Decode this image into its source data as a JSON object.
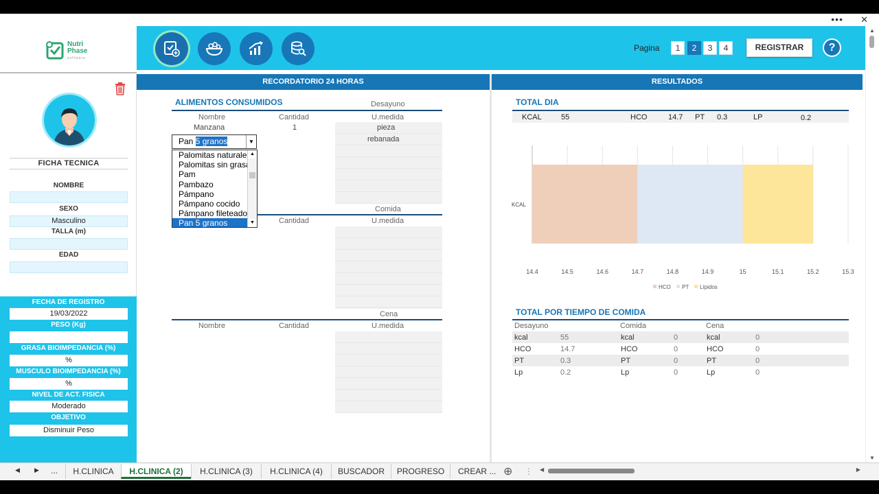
{
  "window": {
    "more": "•••",
    "close": "✕"
  },
  "logo": {
    "line1": "Nutri",
    "line2": "Phase",
    "line3": "software"
  },
  "sidebar": {
    "ficha_title": "FICHA TECNICA",
    "fields": [
      {
        "label": "NOMBRE",
        "value": ""
      },
      {
        "label": "SEXO",
        "value": "Masculino"
      },
      {
        "label": "TALLA (m)",
        "value": ""
      },
      {
        "label": "EDAD",
        "value": ""
      }
    ],
    "cyan_fields": [
      {
        "label": "FECHA DE REGISTRO",
        "value": "19/03/2022"
      },
      {
        "label": "PESO (Kg)",
        "value": ""
      },
      {
        "label": "GRASA BIOIMPEDANCIA (%)",
        "value": "%"
      },
      {
        "label": "MUSCULO BIOIMPEDANCIA (%)",
        "value": "%"
      },
      {
        "label": "NIVEL DE ACT. FISICA",
        "value": "Moderado"
      },
      {
        "label": "OBJETIVO",
        "value": "Disminuir Peso"
      }
    ]
  },
  "header": {
    "icons": [
      "checklist-add-icon",
      "food-bowl-icon",
      "growth-chart-icon",
      "database-search-icon"
    ],
    "pagina_label": "Pagina",
    "pages": [
      "1",
      "2",
      "3",
      "4"
    ],
    "selected_page": "2",
    "register_label": "REGISTRAR",
    "help_label": "?"
  },
  "left": {
    "band": "RECORDATORIO 24 HORAS",
    "title": "ALIMENTOS CONSUMIDOS",
    "meals": [
      {
        "name": "Desayuno",
        "cols": [
          "Nombre",
          "Cantidad",
          "U.medida"
        ],
        "rows": [
          {
            "nombre": "Manzana",
            "cantidad": "1",
            "umedida": "pieza"
          },
          {
            "nombre": "",
            "cantidad": "",
            "umedida": "rebanada"
          }
        ]
      },
      {
        "name": "Comida",
        "cols": [
          "Nombre",
          "Cantidad",
          "U.medida"
        ],
        "rows": []
      },
      {
        "name": "Cena",
        "cols": [
          "Nombre",
          "Cantidad",
          "U.medida"
        ],
        "rows": []
      }
    ],
    "combo": {
      "prefix": "Pan ",
      "highlight": "5 granos"
    },
    "dropdown": [
      "Palomitas naturales",
      "Palomitas sin grasa",
      "Pam",
      "Pambazo",
      "Pámpano",
      "Pámpano cocido",
      "Pámpano fileteado",
      "Pan 5 granos"
    ],
    "dropdown_selected": 7
  },
  "right": {
    "band": "RESULTADOS",
    "total_title": "TOTAL DIA",
    "total_row": [
      {
        "k": "KCAL",
        "v": "55"
      },
      {
        "k": "HCO",
        "v": "14.7"
      },
      {
        "k": "PT",
        "v": "0.3"
      },
      {
        "k": "LP",
        "v": "0.2"
      }
    ],
    "por_tiempo_title": "TOTAL POR TIEMPO DE COMIDA",
    "groups": [
      "Desayuno",
      "Comida",
      "Cena"
    ],
    "rows": [
      {
        "label": "kcal",
        "vals": [
          "55",
          "0",
          "0"
        ]
      },
      {
        "label": "HCO",
        "vals": [
          "14.7",
          "0",
          "0"
        ]
      },
      {
        "label": "PT",
        "vals": [
          "0.3",
          "0",
          "0"
        ]
      },
      {
        "label": "Lp",
        "vals": [
          "0.2",
          "0",
          "0"
        ]
      }
    ]
  },
  "chart_data": {
    "type": "bar",
    "orientation": "horizontal-stacked",
    "categories": [
      "KCAL"
    ],
    "series": [
      {
        "name": "HCO",
        "start": 14.4,
        "end": 14.7,
        "color": "#efcfb9"
      },
      {
        "name": "PT",
        "start": 14.7,
        "end": 15.0,
        "color": "#dde8f4"
      },
      {
        "name": "Lípidos",
        "start": 15.0,
        "end": 15.2,
        "color": "#fde59a"
      }
    ],
    "xlim": [
      14.4,
      15.3
    ],
    "xticks": [
      "14.4",
      "14.5",
      "14.6",
      "14.7",
      "14.8",
      "14.9",
      "15",
      "15.1",
      "15.2",
      "15.3"
    ],
    "grid": true,
    "legend": "bottom"
  },
  "tabs": {
    "nav": [
      "◀",
      "▶",
      "..."
    ],
    "items": [
      "H.CLINICA",
      "H.CLINICA (2)",
      "H.CLINICA (3)",
      "H.CLINICA (4)",
      "BUSCADOR",
      "PROGRESO",
      "CREAR ..."
    ],
    "active": 1,
    "add": "⊕",
    "menu": "⋮"
  },
  "colors": {
    "cyan": "#1ec3ea",
    "blue": "#1676b6",
    "active_tab": "#1e6e3a"
  }
}
